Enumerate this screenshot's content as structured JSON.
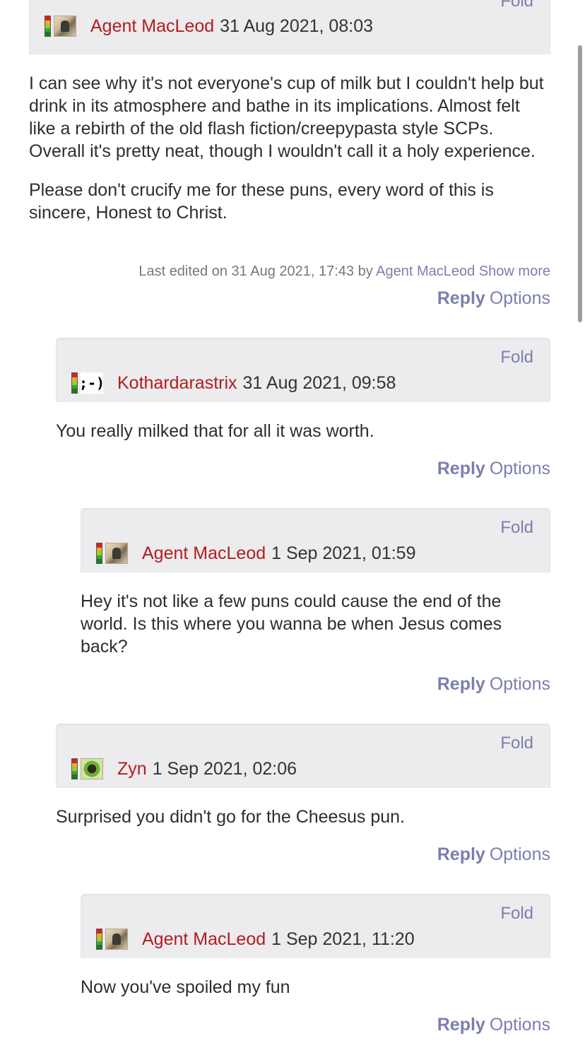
{
  "comments": [
    {
      "fold": "Fold",
      "author": "Agent MacLeod",
      "date": "31 Aug 2021, 08:03",
      "avatar": "macleod-avatar-icon",
      "paragraphs": [
        "I can see why it's not everyone's cup of milk but I couldn't help but drink in its atmosphere and bathe in its implications. Almost felt like a rebirth of the old flash fiction/creepypasta style SCPs. Overall it's pretty neat, though I wouldn't call it a holy experience.",
        "Please don't crucify me for these puns, every word of this is sincere, Honest to Christ."
      ],
      "edited": {
        "prefix": "Last edited on 31 Aug 2021, 17:43 by",
        "by": "Agent MacLeod",
        "show_more": "Show more"
      },
      "reply": "Reply",
      "options": "Options"
    },
    {
      "fold": "Fold",
      "author": "Kothardarastrix",
      "date": "31 Aug 2021, 09:58",
      "avatar": ";-)",
      "paragraphs": [
        "You really milked that for all it was worth."
      ],
      "reply": "Reply",
      "options": "Options"
    },
    {
      "fold": "Fold",
      "author": "Agent MacLeod",
      "date": "1 Sep 2021, 01:59",
      "avatar": "macleod-avatar-icon",
      "paragraphs": [
        "Hey it's not like a few puns could cause the end of the world. Is this where you wanna be when Jesus comes back?"
      ],
      "reply": "Reply",
      "options": "Options"
    },
    {
      "fold": "Fold",
      "author": "Zyn",
      "date": "1 Sep 2021, 02:06",
      "avatar": "zyn-avatar-icon",
      "paragraphs": [
        "Surprised you didn't go for the Cheesus pun."
      ],
      "reply": "Reply",
      "options": "Options"
    },
    {
      "fold": "Fold",
      "author": "Agent MacLeod",
      "date": "1 Sep 2021, 11:20",
      "avatar": "macleod-avatar-icon",
      "paragraphs": [
        "Now you've spoiled my fun"
      ],
      "reply": "Reply",
      "options": "Options"
    }
  ],
  "colors": {
    "author": "#b01e1e",
    "link": "#7b7fae",
    "header_bg": "#ecebee"
  }
}
